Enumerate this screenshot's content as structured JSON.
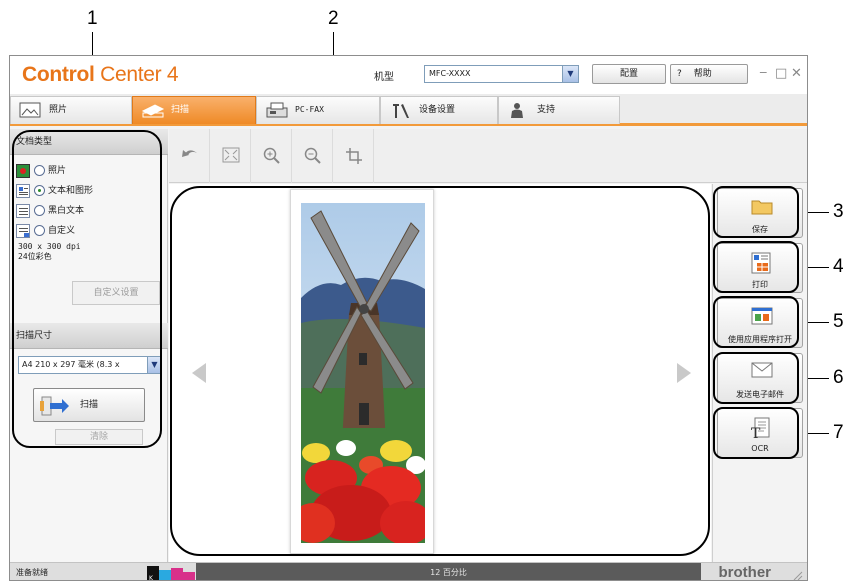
{
  "callouts": [
    "1",
    "2",
    "3",
    "4",
    "5",
    "6",
    "7"
  ],
  "app": {
    "logo_bold": "Control",
    "logo_rest": " Center 4",
    "model_label": "机型",
    "model_value": "MFC-XXXX",
    "config_label": "配置",
    "help_q": "?",
    "help_label": "帮助",
    "win_minimize": "_",
    "win_maximize": "□",
    "win_close": "✕"
  },
  "tabs": [
    {
      "label": "照片",
      "icon": "photo-icon"
    },
    {
      "label": "扫描",
      "icon": "scan-icon",
      "active": true
    },
    {
      "label": "PC-FAX",
      "icon": "fax-icon"
    },
    {
      "label": "设备设置",
      "icon": "tools-icon"
    },
    {
      "label": "支持",
      "icon": "support-icon"
    }
  ],
  "left": {
    "doc_type_header": "文档类型",
    "doc_types": [
      {
        "label": "照片",
        "selected": false
      },
      {
        "label": "文本和图形",
        "selected": true
      },
      {
        "label": "黑白文本",
        "selected": false
      },
      {
        "label": "自定义",
        "selected": false
      }
    ],
    "resolution": "300 x 300 dpi",
    "color_mode": "24位彩色",
    "custom_settings_button": "自定义设置",
    "scan_size_header": "扫描尺寸",
    "scan_size_value": "A4 210 x 297 毫米 (8.3 x",
    "scan_button": "扫描",
    "clear_button": "清除"
  },
  "toolbar": [
    "undo-icon",
    "fit-icon",
    "zoom-in-icon",
    "zoom-out-icon",
    "crop-icon"
  ],
  "actions": [
    {
      "label": "保存",
      "icon": "folder-icon"
    },
    {
      "label": "打印",
      "icon": "print-icon"
    },
    {
      "label": "使用应用程序打开",
      "icon": "open-app-icon"
    },
    {
      "label": "发送电子邮件",
      "icon": "email-icon"
    },
    {
      "label": "OCR",
      "icon": "ocr-icon"
    }
  ],
  "status": {
    "ready": "准备就绪",
    "zoom": "12 百分比",
    "brand": "brother"
  },
  "colors": {
    "accent": "#ef8a26",
    "logo": "#e8751a"
  }
}
